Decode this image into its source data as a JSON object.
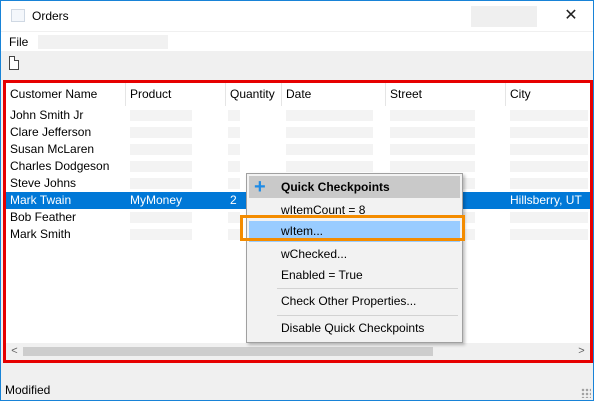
{
  "window": {
    "title": "Orders",
    "close_glyph": "✕"
  },
  "menu": {
    "file": "File"
  },
  "columns": [
    "Customer Name",
    "Product",
    "Quantity",
    "Date",
    "Street",
    "City"
  ],
  "rows": [
    {
      "customer": "John Smith Jr",
      "product": "",
      "quantity": "",
      "city": ""
    },
    {
      "customer": "Clare Jefferson",
      "product": "",
      "quantity": "",
      "city": ""
    },
    {
      "customer": "Susan McLaren",
      "product": "",
      "quantity": "",
      "city": ""
    },
    {
      "customer": "Charles Dodgeson",
      "product": "",
      "quantity": "",
      "city": ""
    },
    {
      "customer": "Steve Johns",
      "product": "",
      "quantity": "",
      "city": ""
    },
    {
      "customer": "Mark Twain",
      "product": "MyMoney",
      "quantity": "2",
      "city": "Hillsberry, UT",
      "selected": true
    },
    {
      "customer": "Bob Feather",
      "product": "",
      "quantity": "",
      "city": ""
    },
    {
      "customer": "Mark Smith",
      "product": "",
      "quantity": "",
      "city": ""
    }
  ],
  "context_menu": {
    "header": "Quick Checkpoints",
    "items": [
      "wItemCount = 8",
      "wItem...",
      "wChecked...",
      "Enabled = True",
      "Check Other Properties...",
      "Disable Quick Checkpoints"
    ],
    "highlighted_index": 1
  },
  "status": {
    "text": "Modified"
  },
  "colors": {
    "selection": "#0078d7",
    "highlight_frame": "#e60000",
    "focus_box": "#f48c00",
    "menu_highlight": "#99ccff",
    "add_icon": "#1e8be6"
  },
  "icons": [
    "app-icon",
    "close-icon",
    "new-document-icon",
    "plus-icon",
    "scroll-left-icon",
    "scroll-right-icon",
    "size-grip-icon"
  ]
}
